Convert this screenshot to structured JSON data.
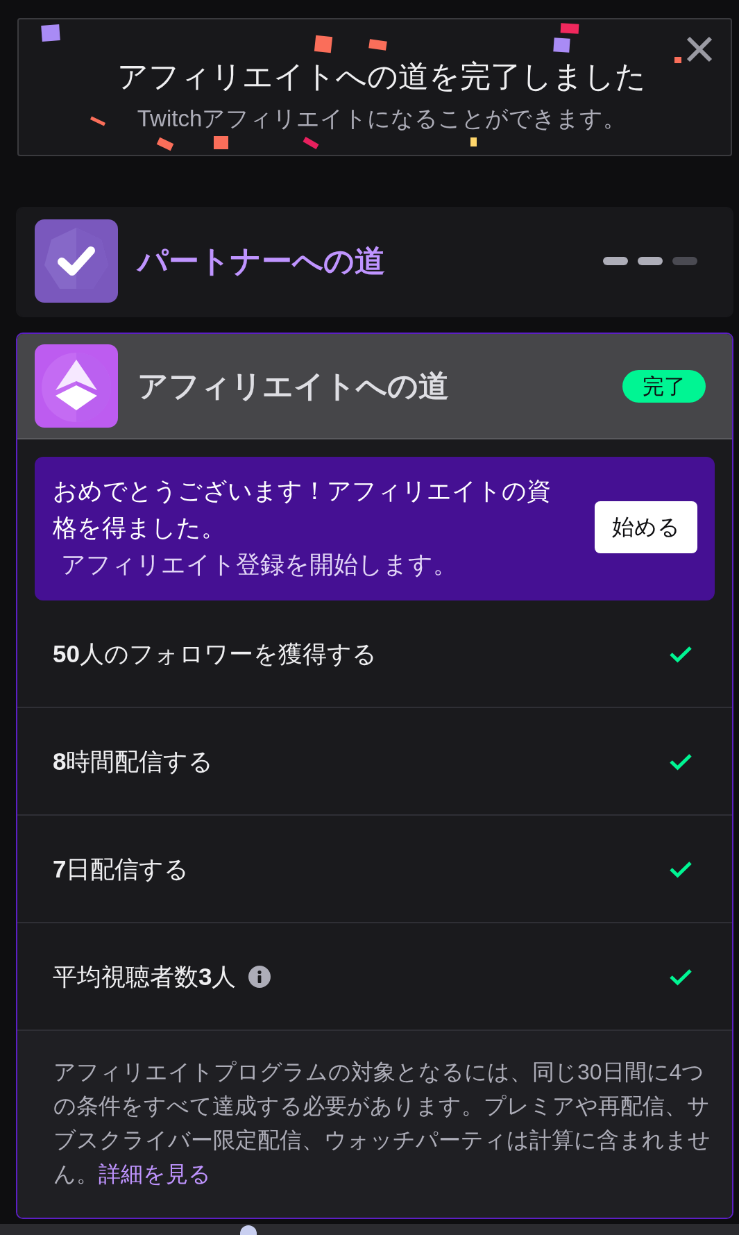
{
  "banner": {
    "title": "アフィリエイトへの道を完了しました",
    "subtitle": "Twitchアフィリエイトになることができます。"
  },
  "paths": [
    {
      "kind": "partner",
      "title": "パートナーへの道",
      "expanded": false,
      "segments": [
        {
          "filled": true
        },
        {
          "filled": true
        },
        {
          "filled": false
        }
      ]
    },
    {
      "kind": "affiliate",
      "title": "アフィリエイトへの道",
      "expanded": true,
      "badge": "完了",
      "notice": {
        "message": "おめでとうございます！アフィリエイトの資格を得ました。",
        "detail": "アフィリエイト登録を開始します。",
        "button": "始める"
      },
      "requirements": [
        {
          "text": "**50**人のフォロワーを獲得する",
          "done": true,
          "info": false
        },
        {
          "text": "**8**時間配信する",
          "done": true,
          "info": false
        },
        {
          "text": "**7**日配信する",
          "done": true,
          "info": false
        },
        {
          "text": "平均視聴者数**3**人",
          "done": true,
          "info": true
        }
      ],
      "footnote": {
        "text": "アフィリエイトプログラムの対象となるには、同じ30日間に4つの条件をすべて達成する必要があります。プレミアや再配信、サブスクライバー限定配信、ウォッチパーティは計算に含まれません。",
        "link": "詳細を見る"
      }
    }
  ]
}
